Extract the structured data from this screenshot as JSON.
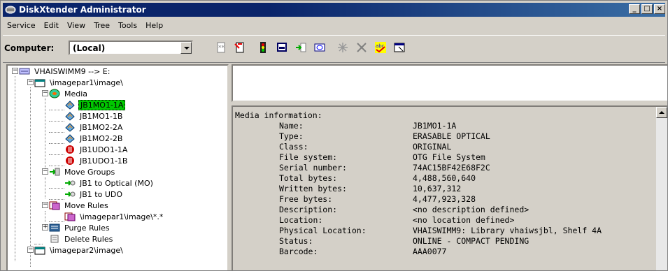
{
  "window": {
    "title": "DiskXtender Administrator"
  },
  "menu": [
    "Service",
    "Edit",
    "View",
    "Tree",
    "Tools",
    "Help"
  ],
  "toolbar": {
    "computer_label": "Computer:",
    "computer_value": "(Local)",
    "icons": [
      "new-icon",
      "red-tool-icon",
      "traffic-light-icon",
      "print-icon",
      "move-icon",
      "media-icon",
      "star-icon",
      "delete-icon",
      "spell-check-icon",
      "properties-icon"
    ]
  },
  "tree": {
    "root": "VHAISWIMM9 --> E:",
    "imagepar1": "\\imagepar1\\image\\",
    "media": "Media",
    "media_items": [
      "JB1MO1-1A",
      "JB1MO1-1B",
      "JB1MO2-2A",
      "JB1MO2-2B",
      "JB1UDO1-1A",
      "JB1UDO1-1B"
    ],
    "move_groups": "Move Groups",
    "move_group_items": [
      "JB1 to Optical (MO)",
      "JB1 to UDO"
    ],
    "move_rules": "Move Rules",
    "move_rule_item": "\\imagepar1\\image\\*.*",
    "purge_rules": "Purge Rules",
    "delete_rules": "Delete Rules",
    "imagepar2": "\\imagepar2\\image\\"
  },
  "info": {
    "header": "Media information:",
    "rows": [
      {
        "k": "Name:",
        "v": "JB1MO1-1A"
      },
      {
        "k": "Type:",
        "v": "ERASABLE OPTICAL"
      },
      {
        "k": "Class:",
        "v": "ORIGINAL"
      },
      {
        "k": "File system:",
        "v": "OTG File System"
      },
      {
        "k": "Serial number:",
        "v": "74AC15BF42E68F2C"
      },
      {
        "k": "Total bytes:",
        "v": "4,488,560,640"
      },
      {
        "k": "Written bytes:",
        "v": "10,637,312"
      },
      {
        "k": "Free bytes:",
        "v": "4,477,923,328"
      },
      {
        "k": "Description:",
        "v": "<no description defined>"
      },
      {
        "k": "Location:",
        "v": "<no location defined>"
      },
      {
        "k": "Physical Location:",
        "v": "VHAISWIMM9: Library vhaiwsjbl, Shelf 4A"
      },
      {
        "k": "Status:",
        "v": "ONLINE - COMPACT PENDING"
      },
      {
        "k": "Barcode:",
        "v": "AAA0077"
      }
    ]
  }
}
